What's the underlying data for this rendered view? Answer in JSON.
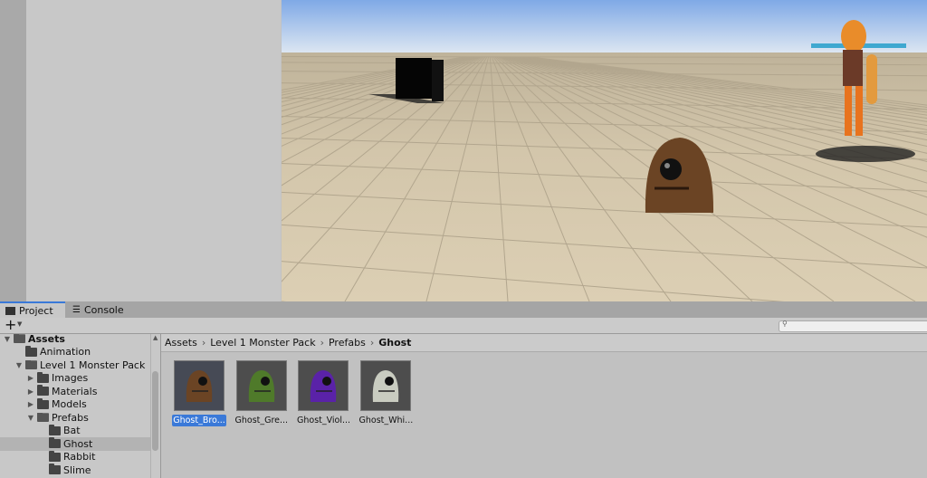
{
  "tabs": [
    {
      "label": "Project",
      "icon": "folder-icon",
      "active": true
    },
    {
      "label": "Console",
      "icon": "console-icon",
      "active": false
    }
  ],
  "toolbar": {
    "add_label": "+",
    "search_placeholder": ""
  },
  "tree": [
    {
      "label": "Assets",
      "depth": 0,
      "expanded": true,
      "bold": true
    },
    {
      "label": "Animation",
      "depth": 1
    },
    {
      "label": "Level 1 Monster Pack",
      "depth": 1,
      "expanded": true
    },
    {
      "label": "Images",
      "depth": 2,
      "collapsed": true
    },
    {
      "label": "Materials",
      "depth": 2,
      "collapsed": true
    },
    {
      "label": "Models",
      "depth": 2,
      "collapsed": true
    },
    {
      "label": "Prefabs",
      "depth": 2,
      "expanded": true
    },
    {
      "label": "Bat",
      "depth": 3
    },
    {
      "label": "Ghost",
      "depth": 3,
      "selected": true
    },
    {
      "label": "Rabbit",
      "depth": 3
    },
    {
      "label": "Slime",
      "depth": 3
    }
  ],
  "breadcrumb": [
    "Assets",
    "Level 1 Monster Pack",
    "Prefabs",
    "Ghost"
  ],
  "assets": [
    {
      "label": "Ghost_Bro...",
      "color": "#6b4424",
      "selected": true
    },
    {
      "label": "Ghost_Gre...",
      "color": "#4f7a2a"
    },
    {
      "label": "Ghost_Viol...",
      "color": "#5a22a8"
    },
    {
      "label": "Ghost_Whi...",
      "color": "#c9ccc0"
    }
  ],
  "colors": {
    "accent": "#3a79d8",
    "sky": "#8fb6ea",
    "ground": "#d5c9ae"
  }
}
